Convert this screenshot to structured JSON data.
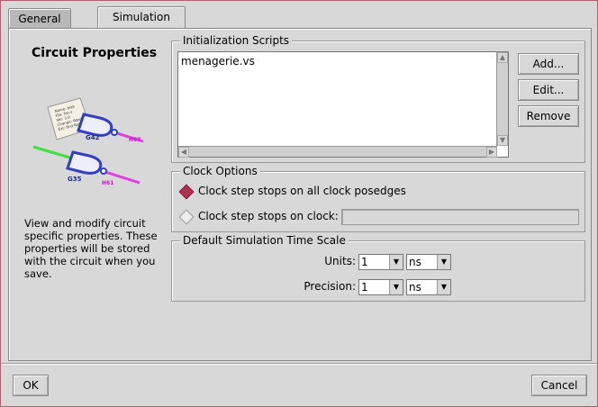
{
  "tabs": [
    {
      "label": "General",
      "active": false
    },
    {
      "label": "Simulation",
      "active": true
    }
  ],
  "sidebar": {
    "title": "Circuit Properties",
    "description_lines": [
      "View and modify circuit",
      "specific properties. These",
      "properties will be stored",
      "with the circuit when you",
      "save."
    ],
    "illustration": {
      "note_lines": [
        "Name: blah",
        "File: foo.v",
        "Ver: 3.0",
        "Change: Wasn",
        "Ext: 8nd  Ret"
      ],
      "gate_labels": [
        "G42",
        "G35"
      ],
      "wire_labels": [
        "H67",
        "H61"
      ],
      "colors": {
        "gate": "#3040c0",
        "wire_pink": "#e040e0",
        "wire_green": "#40e040",
        "paper": "#f4f0e4"
      }
    }
  },
  "init_scripts": {
    "legend": "Initialization Scripts",
    "items": [
      "menagerie.vs"
    ],
    "buttons": {
      "add": "Add...",
      "edit": "Edit...",
      "remove": "Remove"
    }
  },
  "clock_options": {
    "legend": "Clock Options",
    "option_all": "Clock step stops on all clock posedges",
    "option_one": "Clock step stops on clock:",
    "selected": "all",
    "clock_entry_value": ""
  },
  "time_scale": {
    "legend": "Default Simulation Time Scale",
    "units_label": "Units:",
    "units_value": "1",
    "units_unit": "ns",
    "precision_label": "Precision:",
    "precision_value": "1",
    "precision_unit": "ns"
  },
  "footer": {
    "ok": "OK",
    "cancel": "Cancel"
  },
  "colors": {
    "accent": "#b03050",
    "border_frame": "#b06070",
    "background": "#d8d8d8"
  },
  "icons": {
    "dropdown": "chevron-down-icon",
    "radio": "diamond-radio-icon"
  }
}
